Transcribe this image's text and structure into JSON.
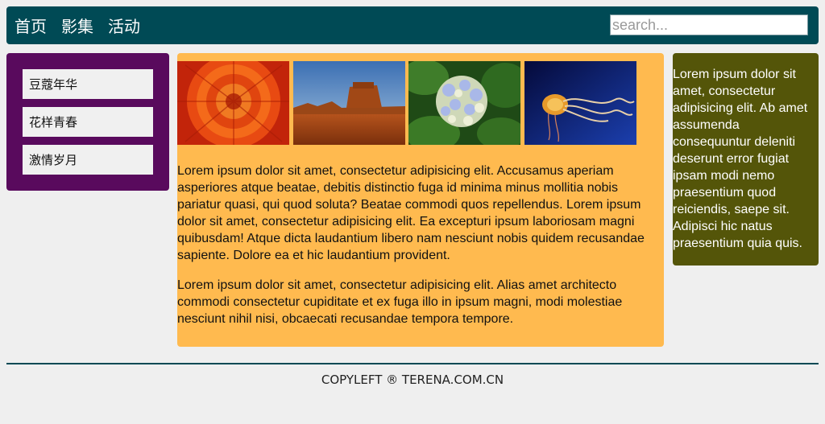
{
  "header": {
    "nav": [
      "首页",
      "影集",
      "活动"
    ],
    "search_placeholder": "search..."
  },
  "sidebar": {
    "items": [
      "豆蔻年华",
      "花样青春",
      "激情岁月"
    ]
  },
  "main": {
    "photos": [
      "orange-flower",
      "desert-mesa",
      "hydrangea",
      "jellyfish"
    ],
    "paragraphs": [
      "Lorem ipsum dolor sit amet, consectetur adipisicing elit. Accusamus aperiam asperiores atque beatae, debitis distinctio fuga id minima minus mollitia nobis pariatur quasi, qui quod soluta? Beatae commodi quos repellendus. Lorem ipsum dolor sit amet, consectetur adipisicing elit. Ea excepturi ipsum laboriosam magni quibusdam! Atque dicta laudantium libero nam nesciunt nobis quidem recusandae sapiente. Dolore ea et hic laudantium provident.",
      "Lorem ipsum dolor sit amet, consectetur adipisicing elit. Alias amet architecto commodi consectetur cupiditate et ex fuga illo in ipsum magni, modi molestiae nesciunt nihil nisi, obcaecati recusandae tempora tempore."
    ]
  },
  "aside": {
    "text": "Lorem ipsum dolor sit amet, consectetur adipisicing elit. Ab amet assumenda consequuntur deleniti deserunt error fugiat ipsam modi nemo praesentium quod reiciendis, saepe sit. Adipisci hic natus praesentium quia quis."
  },
  "footer": {
    "text": "COPYLEFT ® TERENA.COM.CN"
  },
  "colors": {
    "header_bg": "#004a55",
    "sidebar_bg": "#590a5d",
    "main_bg": "#ffba4f",
    "aside_bg": "#545509"
  }
}
